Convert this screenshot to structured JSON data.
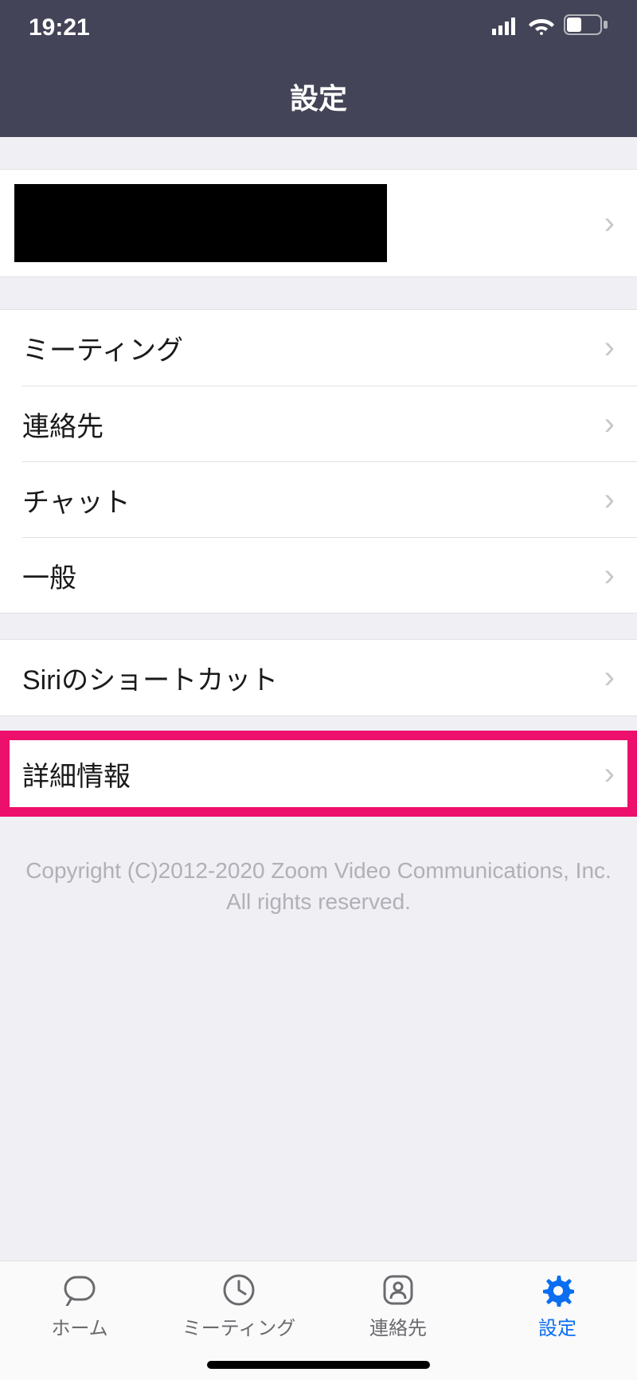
{
  "statusBar": {
    "time": "19:21"
  },
  "header": {
    "title": "設定"
  },
  "rows": {
    "meeting": "ミーティング",
    "contacts": "連絡先",
    "chat": "チャット",
    "general": "一般",
    "siri": "Siriのショートカット",
    "detail": "詳細情報"
  },
  "copyright": {
    "line1": "Copyright (C)2012-2020 Zoom Video Communications, Inc.",
    "line2": "All rights reserved."
  },
  "tabs": {
    "home": "ホーム",
    "meeting": "ミーティング",
    "contacts": "連絡先",
    "settings": "設定"
  }
}
